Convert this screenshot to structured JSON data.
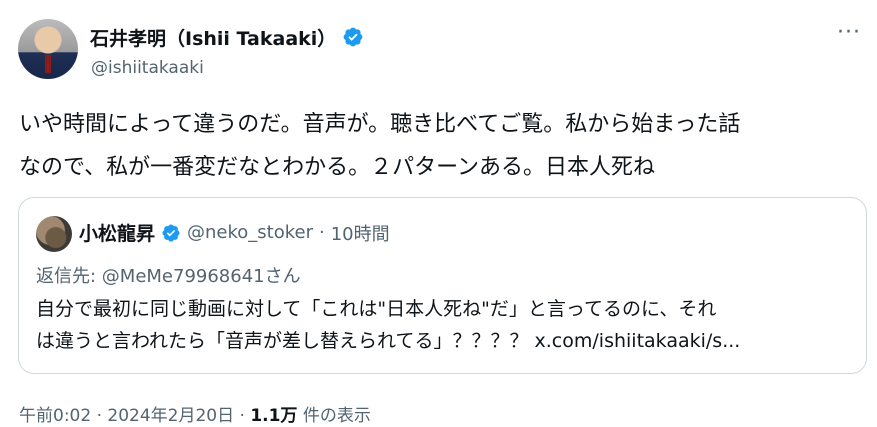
{
  "author": {
    "display_name": "石井孝明（Ishii Takaaki）",
    "handle": "@ishiitakaaki",
    "verified_icon": "verified-badge-icon"
  },
  "more_label": "···",
  "tweet": {
    "text": "いや時間によって違うのだ。音声が。聴き比べてご覧。私から始まった話\nなので、私が一番変だなとわかる。２パターンある。日本人死ね"
  },
  "quote": {
    "display_name": "小松龍昇",
    "handle": "@neko_stoker",
    "separator": "·",
    "time": "10時間",
    "reply_to": "返信先: @MeMe79968641さん",
    "text": "自分で最初に同じ動画に対して「これは\"日本人死ね\"だ」と言ってるのに、それ\nは違うと言われたら「音声が差し替えられてる」？？？？ x.com/ishiitakaaki/s..."
  },
  "footer": {
    "timestamp": "午前0:02 · 2024年2月20日 ·",
    "views_count": "1.1万",
    "views_label": "件の表示"
  },
  "colors": {
    "verified": "#1d9bf0",
    "secondary_text": "#536471",
    "border": "#cfd9de"
  }
}
